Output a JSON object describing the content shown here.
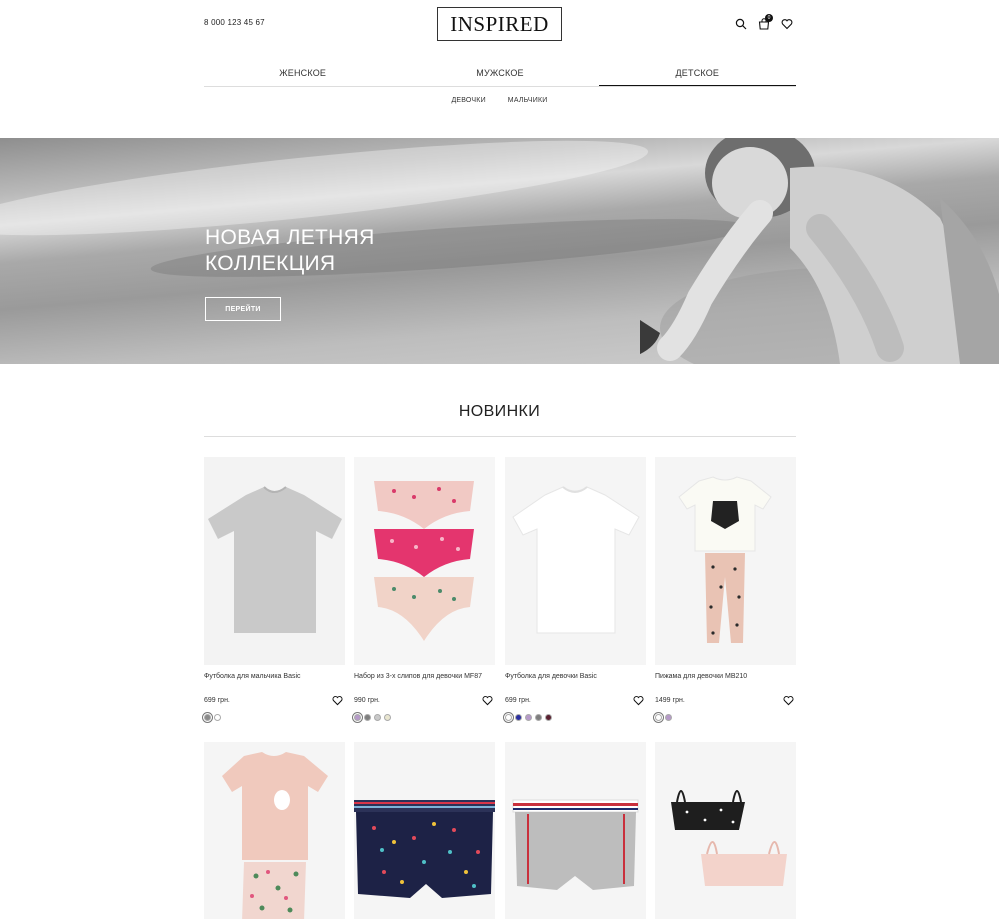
{
  "header": {
    "phone": "8 000 123 45 67",
    "logo": "INSPIRED",
    "icons": [
      "search-icon",
      "cart-icon",
      "heart-icon"
    ],
    "cart_count": "0"
  },
  "categories": [
    {
      "label": "ЖЕНСКОЕ",
      "active": false
    },
    {
      "label": "МУЖСКОЕ",
      "active": false
    },
    {
      "label": "ДЕТСКОЕ",
      "active": true
    }
  ],
  "subcategories": [
    "ДЕВОЧКИ",
    "МАЛЬЧИКИ"
  ],
  "hero": {
    "title_line1": "НОВАЯ ЛЕТНЯЯ",
    "title_line2": "КОЛЛЕКЦИЯ",
    "button": "ПЕРЕЙТИ"
  },
  "new_section": {
    "title": "НОВИНКИ",
    "products": [
      {
        "name": "Футболка для мальчика Basic",
        "price": "699 грн.",
        "colors": [
          "#8a8a8a",
          "#ffffff"
        ]
      },
      {
        "name": "Набор из 3-х слипов для девочки MF87",
        "price": "990 грн.",
        "colors": [
          "#b69ac9",
          "#7e7e7e",
          "#c9c9c9",
          "#e9e6d0"
        ]
      },
      {
        "name": "Футболка для девочки Basic",
        "price": "699 грн.",
        "colors": [
          "#ffffff",
          "#2a2ea0",
          "#b69ac9",
          "#7e7e7e",
          "#5a2030"
        ]
      },
      {
        "name": "Пижама для девочки MB210",
        "price": "1499 грн.",
        "colors": [
          "#ffffff",
          "#b69ac9"
        ]
      },
      {
        "name": "",
        "price": "",
        "colors": []
      },
      {
        "name": "",
        "price": "",
        "colors": []
      },
      {
        "name": "",
        "price": "",
        "colors": []
      },
      {
        "name": "",
        "price": "",
        "colors": []
      }
    ]
  }
}
